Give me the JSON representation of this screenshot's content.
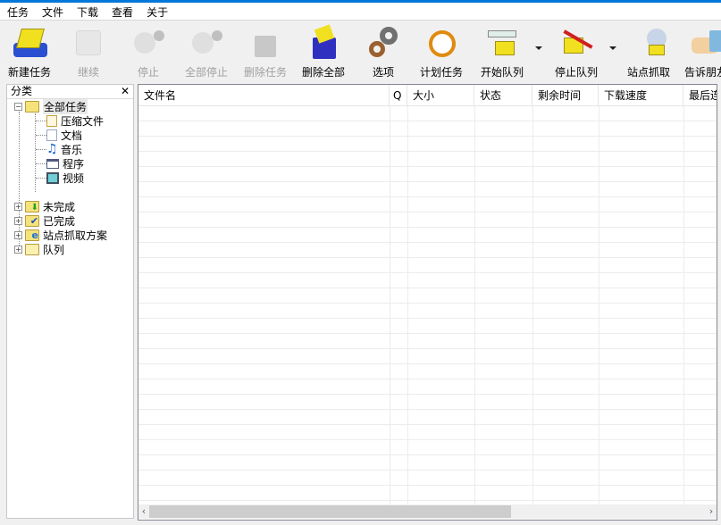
{
  "menu": [
    "任务",
    "文件",
    "下载",
    "查看",
    "关于"
  ],
  "toolbar": [
    {
      "label": "新建任务",
      "icon": "new-task-icon",
      "enabled": true
    },
    {
      "label": "继续",
      "icon": "resume-icon",
      "enabled": false
    },
    {
      "label": "停止",
      "icon": "stop-icon",
      "enabled": false
    },
    {
      "label": "全部停止",
      "icon": "stop-all-icon",
      "enabled": false
    },
    {
      "label": "删除任务",
      "icon": "delete-task-icon",
      "enabled": false
    },
    {
      "label": "删除全部",
      "icon": "delete-all-icon",
      "enabled": true
    },
    {
      "label": "选项",
      "icon": "gear-icon",
      "enabled": true
    },
    {
      "label": "计划任务",
      "icon": "alarm-clock-icon",
      "enabled": true
    },
    {
      "label": "开始队列",
      "icon": "start-queue-icon",
      "enabled": true
    },
    {
      "label": "停止队列",
      "icon": "stop-queue-icon",
      "enabled": true
    },
    {
      "label": "站点抓取",
      "icon": "site-grabber-icon",
      "enabled": true
    },
    {
      "label": "告诉朋友",
      "icon": "tell-friend-icon",
      "enabled": true
    }
  ],
  "sidebar": {
    "title": "分类",
    "close": "✕",
    "root": "全部任务",
    "children": [
      "压缩文件",
      "文档",
      "音乐",
      "程序",
      "视频"
    ],
    "others": [
      "未完成",
      "已完成",
      "站点抓取方案",
      "队列"
    ]
  },
  "columns": [
    "文件名",
    "Q",
    "大小",
    "状态",
    "剩余时间",
    "下载速度",
    "最后连接"
  ],
  "colors": {
    "accent": "#0078d7"
  }
}
